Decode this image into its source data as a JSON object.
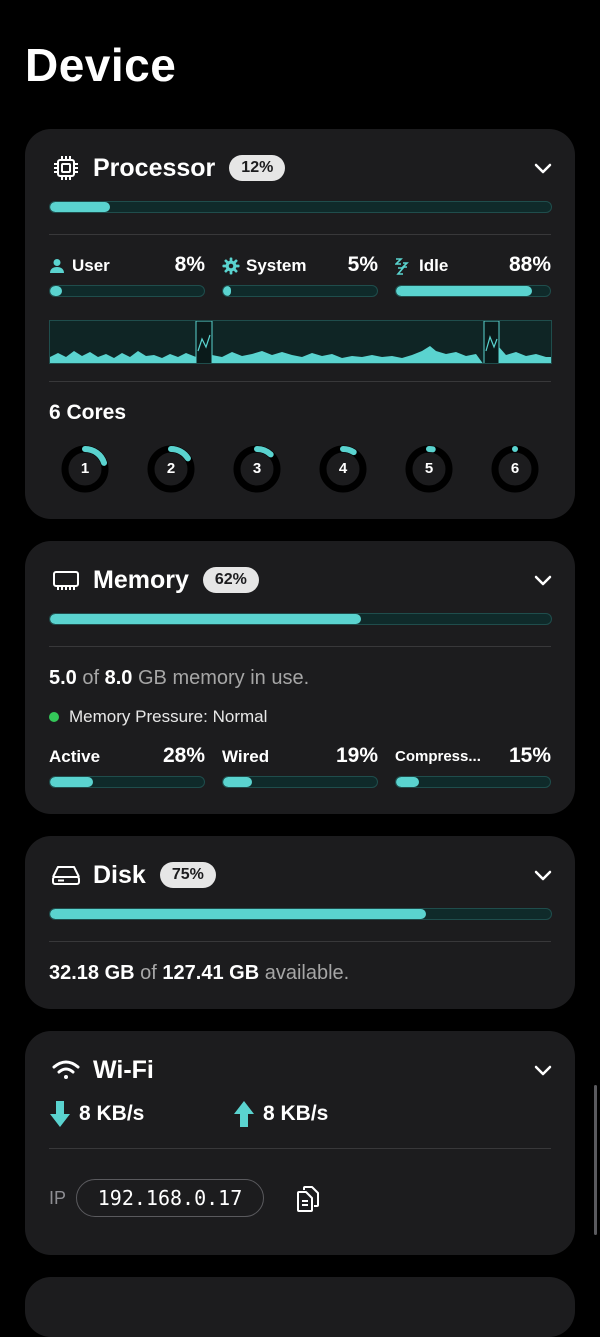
{
  "page": {
    "title": "Device"
  },
  "colors": {
    "accent": "#5ad3cf",
    "card": "#1c1c1e",
    "bar_track": "#0f2a2a",
    "pressure_ok": "#34c759"
  },
  "processor": {
    "title": "Processor",
    "badge": "12%",
    "usage": 0.12,
    "stats": [
      {
        "label": "User",
        "icon": "user-icon",
        "value": "8%",
        "fraction": 0.08
      },
      {
        "label": "System",
        "icon": "gear-icon",
        "value": "5%",
        "fraction": 0.05
      },
      {
        "label": "Idle",
        "icon": "zzz-icon",
        "value": "88%",
        "fraction": 0.88
      }
    ],
    "cores_title": "6 Cores",
    "cores": [
      {
        "label": "1",
        "load": 0.2
      },
      {
        "label": "2",
        "load": 0.16
      },
      {
        "label": "3",
        "load": 0.12
      },
      {
        "label": "4",
        "load": 0.09
      },
      {
        "label": "5",
        "load": 0.03
      },
      {
        "label": "6",
        "load": 0.0
      }
    ]
  },
  "memory": {
    "title": "Memory",
    "badge": "62%",
    "usage": 0.62,
    "used": "5.0",
    "of_text": "of",
    "total": "8.0",
    "suffix": "GB memory in use.",
    "pressure": "Memory Pressure: Normal",
    "stats": [
      {
        "label": "Active",
        "value": "28%",
        "fraction": 0.28
      },
      {
        "label": "Wired",
        "value": "19%",
        "fraction": 0.19
      },
      {
        "label": "Compress...",
        "value": "15%",
        "fraction": 0.15
      }
    ]
  },
  "disk": {
    "title": "Disk",
    "badge": "75%",
    "usage": 0.75,
    "free": "32.18 GB",
    "of_text": "of",
    "total": "127.41 GB",
    "suffix": "available."
  },
  "wifi": {
    "title": "Wi-Fi",
    "download": "8 KB/s",
    "upload": "8 KB/s",
    "ip_label": "IP",
    "ip": "192.168.0.17"
  }
}
